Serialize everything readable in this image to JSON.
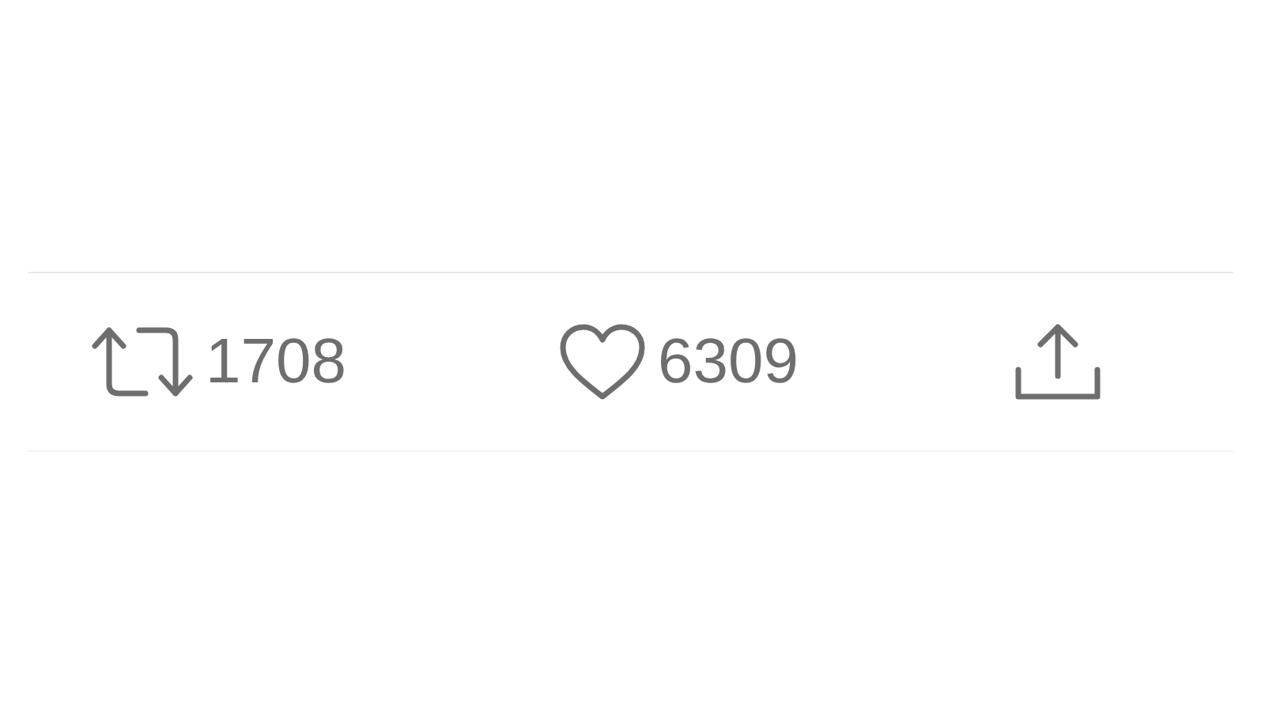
{
  "actions": [
    {
      "kind": "retweet",
      "count": "1708"
    },
    {
      "kind": "like",
      "count": "6309"
    },
    {
      "kind": "share"
    }
  ]
}
